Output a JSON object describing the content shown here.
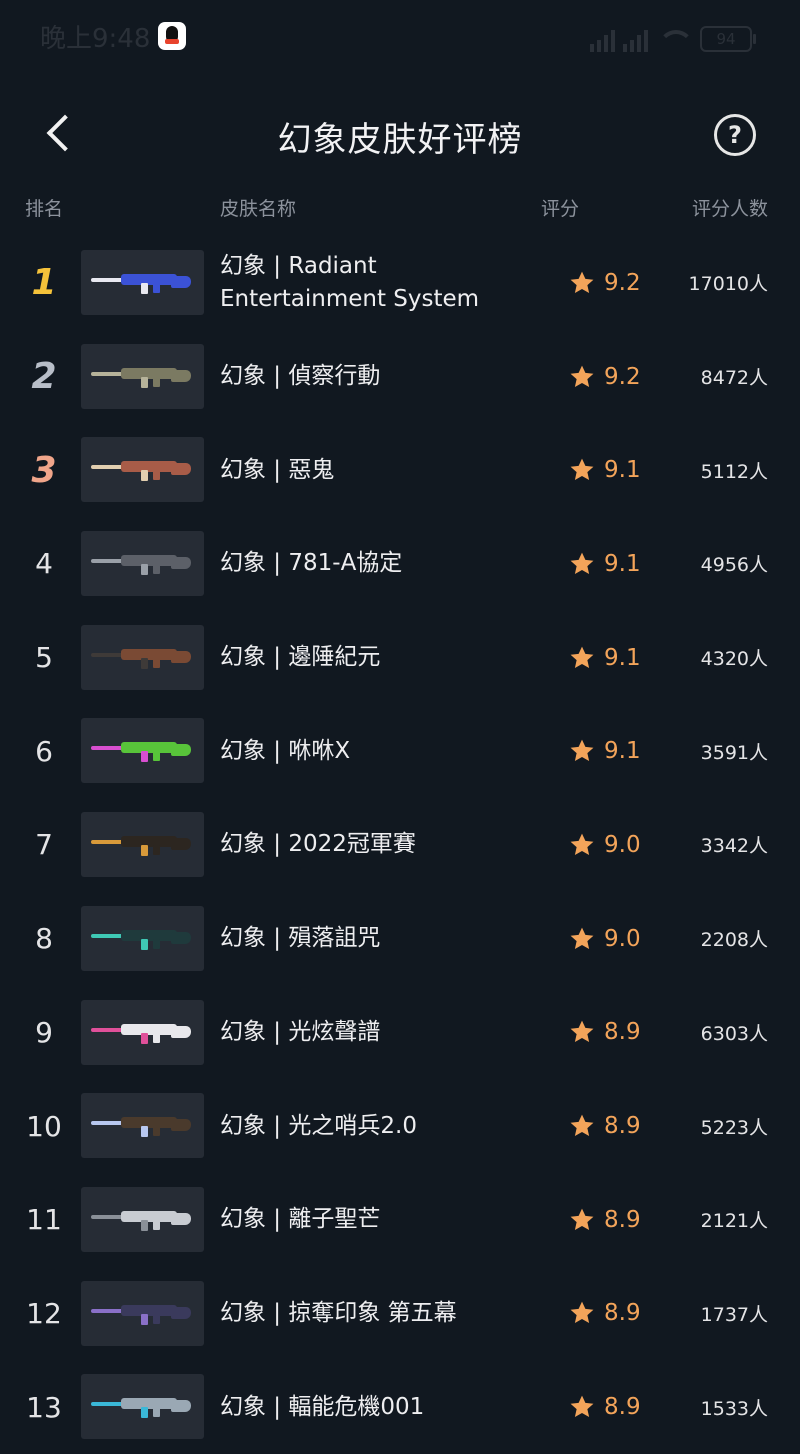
{
  "status": {
    "time": "晚上9:48",
    "battery": "94"
  },
  "header": {
    "title": "幻象皮肤好评榜",
    "back_icon": "back-icon",
    "help_icon": "?"
  },
  "columns": {
    "rank": "排名",
    "name": "皮肤名称",
    "score": "评分",
    "count": "评分人数"
  },
  "colors": {
    "background": "#111820",
    "accent_score": "#f3a45a",
    "star": "#f3a45a",
    "rank1": "#f5c23a",
    "rank2": "#b8bec8",
    "rank3": "#f0a58a"
  },
  "rows": [
    {
      "rank": "1",
      "name": "幻象 | Radiant Entertainment System",
      "score": "9.2",
      "count": "17010人",
      "gun_color": "#3b52d6",
      "accent": "#e8e8f0"
    },
    {
      "rank": "2",
      "name": "幻象 | 偵察行動",
      "score": "9.2",
      "count": "8472人",
      "gun_color": "#7b7a62",
      "accent": "#b6b39a"
    },
    {
      "rank": "3",
      "name": "幻象 | 惡鬼",
      "score": "9.1",
      "count": "5112人",
      "gun_color": "#a85c48",
      "accent": "#e2cfb0"
    },
    {
      "rank": "4",
      "name": "幻象 | 781-A協定",
      "score": "9.1",
      "count": "4956人",
      "gun_color": "#5c6068",
      "accent": "#9aa0a8"
    },
    {
      "rank": "5",
      "name": "幻象 | 邊陲紀元",
      "score": "9.1",
      "count": "4320人",
      "gun_color": "#7a4a34",
      "accent": "#3e3a38"
    },
    {
      "rank": "6",
      "name": "幻象 | 咻咻X",
      "score": "9.1",
      "count": "3591人",
      "gun_color": "#58c43a",
      "accent": "#d84fd0"
    },
    {
      "rank": "7",
      "name": "幻象 | 2022冠軍賽",
      "score": "9.0",
      "count": "3342人",
      "gun_color": "#2c2620",
      "accent": "#d89a3a"
    },
    {
      "rank": "8",
      "name": "幻象 | 殞落詛咒",
      "score": "9.0",
      "count": "2208人",
      "gun_color": "#1f3a3c",
      "accent": "#3fc8b4"
    },
    {
      "rank": "9",
      "name": "幻象 | 光炫聲譜",
      "score": "8.9",
      "count": "6303人",
      "gun_color": "#e8e8ec",
      "accent": "#e0509a"
    },
    {
      "rank": "10",
      "name": "幻象 | 光之哨兵2.0",
      "score": "8.9",
      "count": "5223人",
      "gun_color": "#4a3a2c",
      "accent": "#b8c8f0"
    },
    {
      "rank": "11",
      "name": "幻象 | 離子聖芒",
      "score": "8.9",
      "count": "2121人",
      "gun_color": "#c8ccd2",
      "accent": "#8a9098"
    },
    {
      "rank": "12",
      "name": "幻象 | 掠奪印象 第五幕",
      "score": "8.9",
      "count": "1737人",
      "gun_color": "#3a3a5c",
      "accent": "#8a70c8"
    },
    {
      "rank": "13",
      "name": "幻象 | 輻能危機001",
      "score": "8.9",
      "count": "1533人",
      "gun_color": "#9aa8b4",
      "accent": "#3ab8d8"
    }
  ]
}
